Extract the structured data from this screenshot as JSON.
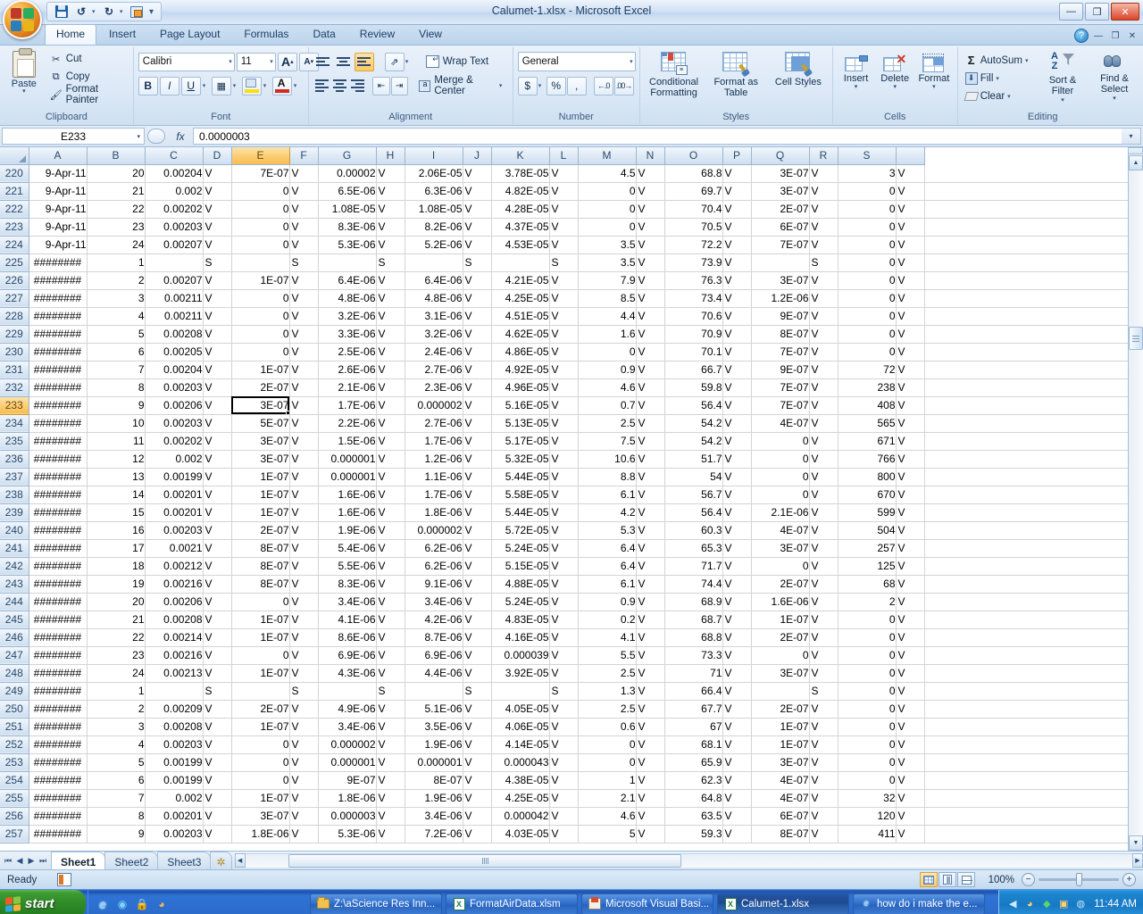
{
  "window": {
    "title": "Calumet-1.xlsx - Microsoft Excel",
    "minimize": "—",
    "maximize": "❐",
    "close": "✕"
  },
  "quick_access": {
    "save": "save-icon",
    "undo": "↺",
    "redo": "↻",
    "print_preview": "print-icon",
    "customize": "▾"
  },
  "ribbon": {
    "tabs": [
      {
        "label": "Home",
        "active": true
      },
      {
        "label": "Insert",
        "active": false
      },
      {
        "label": "Page Layout",
        "active": false
      },
      {
        "label": "Formulas",
        "active": false
      },
      {
        "label": "Data",
        "active": false
      },
      {
        "label": "Review",
        "active": false
      },
      {
        "label": "View",
        "active": false
      }
    ],
    "help_label": "?",
    "groups": {
      "clipboard": {
        "label": "Clipboard",
        "paste": "Paste",
        "cut": "Cut",
        "copy": "Copy",
        "format_painter": "Format Painter"
      },
      "font": {
        "label": "Font",
        "font_name": "Calibri",
        "font_size": "11",
        "grow": "A",
        "shrink": "A",
        "bold": "B",
        "italic": "I",
        "underline": "U",
        "borders": "▦",
        "fill_color": "fill-color-icon",
        "font_color": "A"
      },
      "alignment": {
        "label": "Alignment",
        "wrap_text": "Wrap Text",
        "merge_center": "Merge & Center"
      },
      "number": {
        "label": "Number",
        "format": "General",
        "currency": "$",
        "percent": "%",
        "comma": ",",
        "increase_decimal": ".00",
        "decrease_decimal": ".00"
      },
      "styles": {
        "label": "Styles",
        "conditional_formatting": "Conditional Formatting",
        "format_as_table": "Format as Table",
        "cell_styles": "Cell Styles"
      },
      "cells": {
        "label": "Cells",
        "insert": "Insert",
        "delete": "Delete",
        "format": "Format"
      },
      "editing": {
        "label": "Editing",
        "autosum": "AutoSum",
        "fill": "Fill",
        "clear": "Clear",
        "sort_filter": "Sort & Filter",
        "find_select": "Find & Select"
      }
    }
  },
  "formula_bar": {
    "name_box": "E233",
    "fx": "fx",
    "value": "0.0000003",
    "expand": "▾"
  },
  "grid": {
    "selected_cell": "E233",
    "selected_column": "E",
    "selected_row": "233",
    "columns": [
      "A",
      "B",
      "C",
      "D",
      "E",
      "F",
      "G",
      "H",
      "I",
      "J",
      "K",
      "L",
      "M",
      "N",
      "O",
      "P",
      "Q",
      "R",
      "S"
    ],
    "rows": [
      {
        "num": "220",
        "cells": [
          "9-Apr-11",
          "20",
          "0.00204",
          "V",
          "7E-07",
          "V",
          "0.00002",
          "V",
          "2.06E-05",
          "V",
          "3.78E-05",
          "V",
          "4.5",
          "V",
          "68.8",
          "V",
          "3E-07",
          "V",
          "3",
          "V"
        ]
      },
      {
        "num": "221",
        "cells": [
          "9-Apr-11",
          "21",
          "0.002",
          "V",
          "0",
          "V",
          "6.5E-06",
          "V",
          "6.3E-06",
          "V",
          "4.82E-05",
          "V",
          "0",
          "V",
          "69.7",
          "V",
          "3E-07",
          "V",
          "0",
          "V"
        ]
      },
      {
        "num": "222",
        "cells": [
          "9-Apr-11",
          "22",
          "0.00202",
          "V",
          "0",
          "V",
          "1.08E-05",
          "V",
          "1.08E-05",
          "V",
          "4.28E-05",
          "V",
          "0",
          "V",
          "70.4",
          "V",
          "2E-07",
          "V",
          "0",
          "V"
        ]
      },
      {
        "num": "223",
        "cells": [
          "9-Apr-11",
          "23",
          "0.00203",
          "V",
          "0",
          "V",
          "8.3E-06",
          "V",
          "8.2E-06",
          "V",
          "4.37E-05",
          "V",
          "0",
          "V",
          "70.5",
          "V",
          "6E-07",
          "V",
          "0",
          "V"
        ]
      },
      {
        "num": "224",
        "cells": [
          "9-Apr-11",
          "24",
          "0.00207",
          "V",
          "0",
          "V",
          "5.3E-06",
          "V",
          "5.2E-06",
          "V",
          "4.53E-05",
          "V",
          "3.5",
          "V",
          "72.2",
          "V",
          "7E-07",
          "V",
          "0",
          "V"
        ]
      },
      {
        "num": "225",
        "cells": [
          "########",
          "1",
          "",
          "S",
          "",
          "S",
          "",
          "S",
          "",
          "S",
          "",
          "S",
          "3.5",
          "V",
          "73.9",
          "V",
          "",
          "S",
          "0",
          "V"
        ]
      },
      {
        "num": "226",
        "cells": [
          "########",
          "2",
          "0.00207",
          "V",
          "1E-07",
          "V",
          "6.4E-06",
          "V",
          "6.4E-06",
          "V",
          "4.21E-05",
          "V",
          "7.9",
          "V",
          "76.3",
          "V",
          "3E-07",
          "V",
          "0",
          "V"
        ]
      },
      {
        "num": "227",
        "cells": [
          "########",
          "3",
          "0.00211",
          "V",
          "0",
          "V",
          "4.8E-06",
          "V",
          "4.8E-06",
          "V",
          "4.25E-05",
          "V",
          "8.5",
          "V",
          "73.4",
          "V",
          "1.2E-06",
          "V",
          "0",
          "V"
        ]
      },
      {
        "num": "228",
        "cells": [
          "########",
          "4",
          "0.00211",
          "V",
          "0",
          "V",
          "3.2E-06",
          "V",
          "3.1E-06",
          "V",
          "4.51E-05",
          "V",
          "4.4",
          "V",
          "70.6",
          "V",
          "9E-07",
          "V",
          "0",
          "V"
        ]
      },
      {
        "num": "229",
        "cells": [
          "########",
          "5",
          "0.00208",
          "V",
          "0",
          "V",
          "3.3E-06",
          "V",
          "3.2E-06",
          "V",
          "4.62E-05",
          "V",
          "1.6",
          "V",
          "70.9",
          "V",
          "8E-07",
          "V",
          "0",
          "V"
        ]
      },
      {
        "num": "230",
        "cells": [
          "########",
          "6",
          "0.00205",
          "V",
          "0",
          "V",
          "2.5E-06",
          "V",
          "2.4E-06",
          "V",
          "4.86E-05",
          "V",
          "0",
          "V",
          "70.1",
          "V",
          "7E-07",
          "V",
          "0",
          "V"
        ]
      },
      {
        "num": "231",
        "cells": [
          "########",
          "7",
          "0.00204",
          "V",
          "1E-07",
          "V",
          "2.6E-06",
          "V",
          "2.7E-06",
          "V",
          "4.92E-05",
          "V",
          "0.9",
          "V",
          "66.7",
          "V",
          "9E-07",
          "V",
          "72",
          "V"
        ]
      },
      {
        "num": "232",
        "cells": [
          "########",
          "8",
          "0.00203",
          "V",
          "2E-07",
          "V",
          "2.1E-06",
          "V",
          "2.3E-06",
          "V",
          "4.96E-05",
          "V",
          "4.6",
          "V",
          "59.8",
          "V",
          "7E-07",
          "V",
          "238",
          "V"
        ]
      },
      {
        "num": "233",
        "cells": [
          "########",
          "9",
          "0.00206",
          "V",
          "3E-07",
          "V",
          "1.7E-06",
          "V",
          "0.000002",
          "V",
          "5.16E-05",
          "V",
          "0.7",
          "V",
          "56.4",
          "V",
          "7E-07",
          "V",
          "408",
          "V"
        ]
      },
      {
        "num": "234",
        "cells": [
          "########",
          "10",
          "0.00203",
          "V",
          "5E-07",
          "V",
          "2.2E-06",
          "V",
          "2.7E-06",
          "V",
          "5.13E-05",
          "V",
          "2.5",
          "V",
          "54.2",
          "V",
          "4E-07",
          "V",
          "565",
          "V"
        ]
      },
      {
        "num": "235",
        "cells": [
          "########",
          "11",
          "0.00202",
          "V",
          "3E-07",
          "V",
          "1.5E-06",
          "V",
          "1.7E-06",
          "V",
          "5.17E-05",
          "V",
          "7.5",
          "V",
          "54.2",
          "V",
          "0",
          "V",
          "671",
          "V"
        ]
      },
      {
        "num": "236",
        "cells": [
          "########",
          "12",
          "0.002",
          "V",
          "3E-07",
          "V",
          "0.000001",
          "V",
          "1.2E-06",
          "V",
          "5.32E-05",
          "V",
          "10.6",
          "V",
          "51.7",
          "V",
          "0",
          "V",
          "766",
          "V"
        ]
      },
      {
        "num": "237",
        "cells": [
          "########",
          "13",
          "0.00199",
          "V",
          "1E-07",
          "V",
          "0.000001",
          "V",
          "1.1E-06",
          "V",
          "5.44E-05",
          "V",
          "8.8",
          "V",
          "54",
          "V",
          "0",
          "V",
          "800",
          "V"
        ]
      },
      {
        "num": "238",
        "cells": [
          "########",
          "14",
          "0.00201",
          "V",
          "1E-07",
          "V",
          "1.6E-06",
          "V",
          "1.7E-06",
          "V",
          "5.58E-05",
          "V",
          "6.1",
          "V",
          "56.7",
          "V",
          "0",
          "V",
          "670",
          "V"
        ]
      },
      {
        "num": "239",
        "cells": [
          "########",
          "15",
          "0.00201",
          "V",
          "1E-07",
          "V",
          "1.6E-06",
          "V",
          "1.8E-06",
          "V",
          "5.44E-05",
          "V",
          "4.2",
          "V",
          "56.4",
          "V",
          "2.1E-06",
          "V",
          "599",
          "V"
        ]
      },
      {
        "num": "240",
        "cells": [
          "########",
          "16",
          "0.00203",
          "V",
          "2E-07",
          "V",
          "1.9E-06",
          "V",
          "0.000002",
          "V",
          "5.72E-05",
          "V",
          "5.3",
          "V",
          "60.3",
          "V",
          "4E-07",
          "V",
          "504",
          "V"
        ]
      },
      {
        "num": "241",
        "cells": [
          "########",
          "17",
          "0.0021",
          "V",
          "8E-07",
          "V",
          "5.4E-06",
          "V",
          "6.2E-06",
          "V",
          "5.24E-05",
          "V",
          "6.4",
          "V",
          "65.3",
          "V",
          "3E-07",
          "V",
          "257",
          "V"
        ]
      },
      {
        "num": "242",
        "cells": [
          "########",
          "18",
          "0.00212",
          "V",
          "8E-07",
          "V",
          "5.5E-06",
          "V",
          "6.2E-06",
          "V",
          "5.15E-05",
          "V",
          "6.4",
          "V",
          "71.7",
          "V",
          "0",
          "V",
          "125",
          "V"
        ]
      },
      {
        "num": "243",
        "cells": [
          "########",
          "19",
          "0.00216",
          "V",
          "8E-07",
          "V",
          "8.3E-06",
          "V",
          "9.1E-06",
          "V",
          "4.88E-05",
          "V",
          "6.1",
          "V",
          "74.4",
          "V",
          "2E-07",
          "V",
          "68",
          "V"
        ]
      },
      {
        "num": "244",
        "cells": [
          "########",
          "20",
          "0.00206",
          "V",
          "0",
          "V",
          "3.4E-06",
          "V",
          "3.4E-06",
          "V",
          "5.24E-05",
          "V",
          "0.9",
          "V",
          "68.9",
          "V",
          "1.6E-06",
          "V",
          "2",
          "V"
        ]
      },
      {
        "num": "245",
        "cells": [
          "########",
          "21",
          "0.00208",
          "V",
          "1E-07",
          "V",
          "4.1E-06",
          "V",
          "4.2E-06",
          "V",
          "4.83E-05",
          "V",
          "0.2",
          "V",
          "68.7",
          "V",
          "1E-07",
          "V",
          "0",
          "V"
        ]
      },
      {
        "num": "246",
        "cells": [
          "########",
          "22",
          "0.00214",
          "V",
          "1E-07",
          "V",
          "8.6E-06",
          "V",
          "8.7E-06",
          "V",
          "4.16E-05",
          "V",
          "4.1",
          "V",
          "68.8",
          "V",
          "2E-07",
          "V",
          "0",
          "V"
        ]
      },
      {
        "num": "247",
        "cells": [
          "########",
          "23",
          "0.00216",
          "V",
          "0",
          "V",
          "6.9E-06",
          "V",
          "6.9E-06",
          "V",
          "0.000039",
          "V",
          "5.5",
          "V",
          "73.3",
          "V",
          "0",
          "V",
          "0",
          "V"
        ]
      },
      {
        "num": "248",
        "cells": [
          "########",
          "24",
          "0.00213",
          "V",
          "1E-07",
          "V",
          "4.3E-06",
          "V",
          "4.4E-06",
          "V",
          "3.92E-05",
          "V",
          "2.5",
          "V",
          "71",
          "V",
          "3E-07",
          "V",
          "0",
          "V"
        ]
      },
      {
        "num": "249",
        "cells": [
          "########",
          "1",
          "",
          "S",
          "",
          "S",
          "",
          "S",
          "",
          "S",
          "",
          "S",
          "1.3",
          "V",
          "66.4",
          "V",
          "",
          "S",
          "0",
          "V"
        ]
      },
      {
        "num": "250",
        "cells": [
          "########",
          "2",
          "0.00209",
          "V",
          "2E-07",
          "V",
          "4.9E-06",
          "V",
          "5.1E-06",
          "V",
          "4.05E-05",
          "V",
          "2.5",
          "V",
          "67.7",
          "V",
          "2E-07",
          "V",
          "0",
          "V"
        ]
      },
      {
        "num": "251",
        "cells": [
          "########",
          "3",
          "0.00208",
          "V",
          "1E-07",
          "V",
          "3.4E-06",
          "V",
          "3.5E-06",
          "V",
          "4.06E-05",
          "V",
          "0.6",
          "V",
          "67",
          "V",
          "1E-07",
          "V",
          "0",
          "V"
        ]
      },
      {
        "num": "252",
        "cells": [
          "########",
          "4",
          "0.00203",
          "V",
          "0",
          "V",
          "0.000002",
          "V",
          "1.9E-06",
          "V",
          "4.14E-05",
          "V",
          "0",
          "V",
          "68.1",
          "V",
          "1E-07",
          "V",
          "0",
          "V"
        ]
      },
      {
        "num": "253",
        "cells": [
          "########",
          "5",
          "0.00199",
          "V",
          "0",
          "V",
          "0.000001",
          "V",
          "0.000001",
          "V",
          "0.000043",
          "V",
          "0",
          "V",
          "65.9",
          "V",
          "3E-07",
          "V",
          "0",
          "V"
        ]
      },
      {
        "num": "254",
        "cells": [
          "########",
          "6",
          "0.00199",
          "V",
          "0",
          "V",
          "9E-07",
          "V",
          "8E-07",
          "V",
          "4.38E-05",
          "V",
          "1",
          "V",
          "62.3",
          "V",
          "4E-07",
          "V",
          "0",
          "V"
        ]
      },
      {
        "num": "255",
        "cells": [
          "########",
          "7",
          "0.002",
          "V",
          "1E-07",
          "V",
          "1.8E-06",
          "V",
          "1.9E-06",
          "V",
          "4.25E-05",
          "V",
          "2.1",
          "V",
          "64.8",
          "V",
          "4E-07",
          "V",
          "32",
          "V"
        ]
      },
      {
        "num": "256",
        "cells": [
          "########",
          "8",
          "0.00201",
          "V",
          "3E-07",
          "V",
          "0.000003",
          "V",
          "3.4E-06",
          "V",
          "0.000042",
          "V",
          "4.6",
          "V",
          "63.5",
          "V",
          "6E-07",
          "V",
          "120",
          "V"
        ]
      },
      {
        "num": "257",
        "cells": [
          "########",
          "9",
          "0.00203",
          "V",
          "1.8E-06",
          "V",
          "5.3E-06",
          "V",
          "7.2E-06",
          "V",
          "4.03E-05",
          "V",
          "5",
          "V",
          "59.3",
          "V",
          "8E-07",
          "V",
          "411",
          "V"
        ]
      }
    ]
  },
  "sheet_tabs": {
    "first": "⏮",
    "prev": "◀",
    "next": "▶",
    "last": "⏭",
    "tabs": [
      {
        "label": "Sheet1",
        "active": true
      },
      {
        "label": "Sheet2",
        "active": false
      },
      {
        "label": "Sheet3",
        "active": false
      }
    ],
    "new_sheet": "new-sheet-icon"
  },
  "status_bar": {
    "mode": "Ready",
    "zoom_level": "100%",
    "zoom_out": "−",
    "zoom_in": "+",
    "views": [
      "normal-view",
      "page-layout-view",
      "page-break-view"
    ]
  },
  "taskbar": {
    "start_label": "start",
    "quick_launch": [
      "internet-explorer-icon",
      "media-icon",
      "lock-icon",
      "clock-icon"
    ],
    "buttons": [
      {
        "label": "Z:\\aScience Res Inn...",
        "icon": "folder-icon",
        "active": false
      },
      {
        "label": "FormatAirData.xlsm",
        "icon": "excel-icon",
        "active": false
      },
      {
        "label": "Microsoft Visual Basi...",
        "icon": "vb-icon",
        "active": false
      },
      {
        "label": "Calumet-1.xlsx",
        "icon": "excel-icon",
        "active": true
      },
      {
        "label": "how do i make the e...",
        "icon": "internet-explorer-icon",
        "active": false
      }
    ],
    "tray_icons": [
      "chevron-left-icon",
      "clock-icon",
      "shield-icon",
      "update-icon",
      "network-icon"
    ],
    "clock": "11:44 AM"
  }
}
